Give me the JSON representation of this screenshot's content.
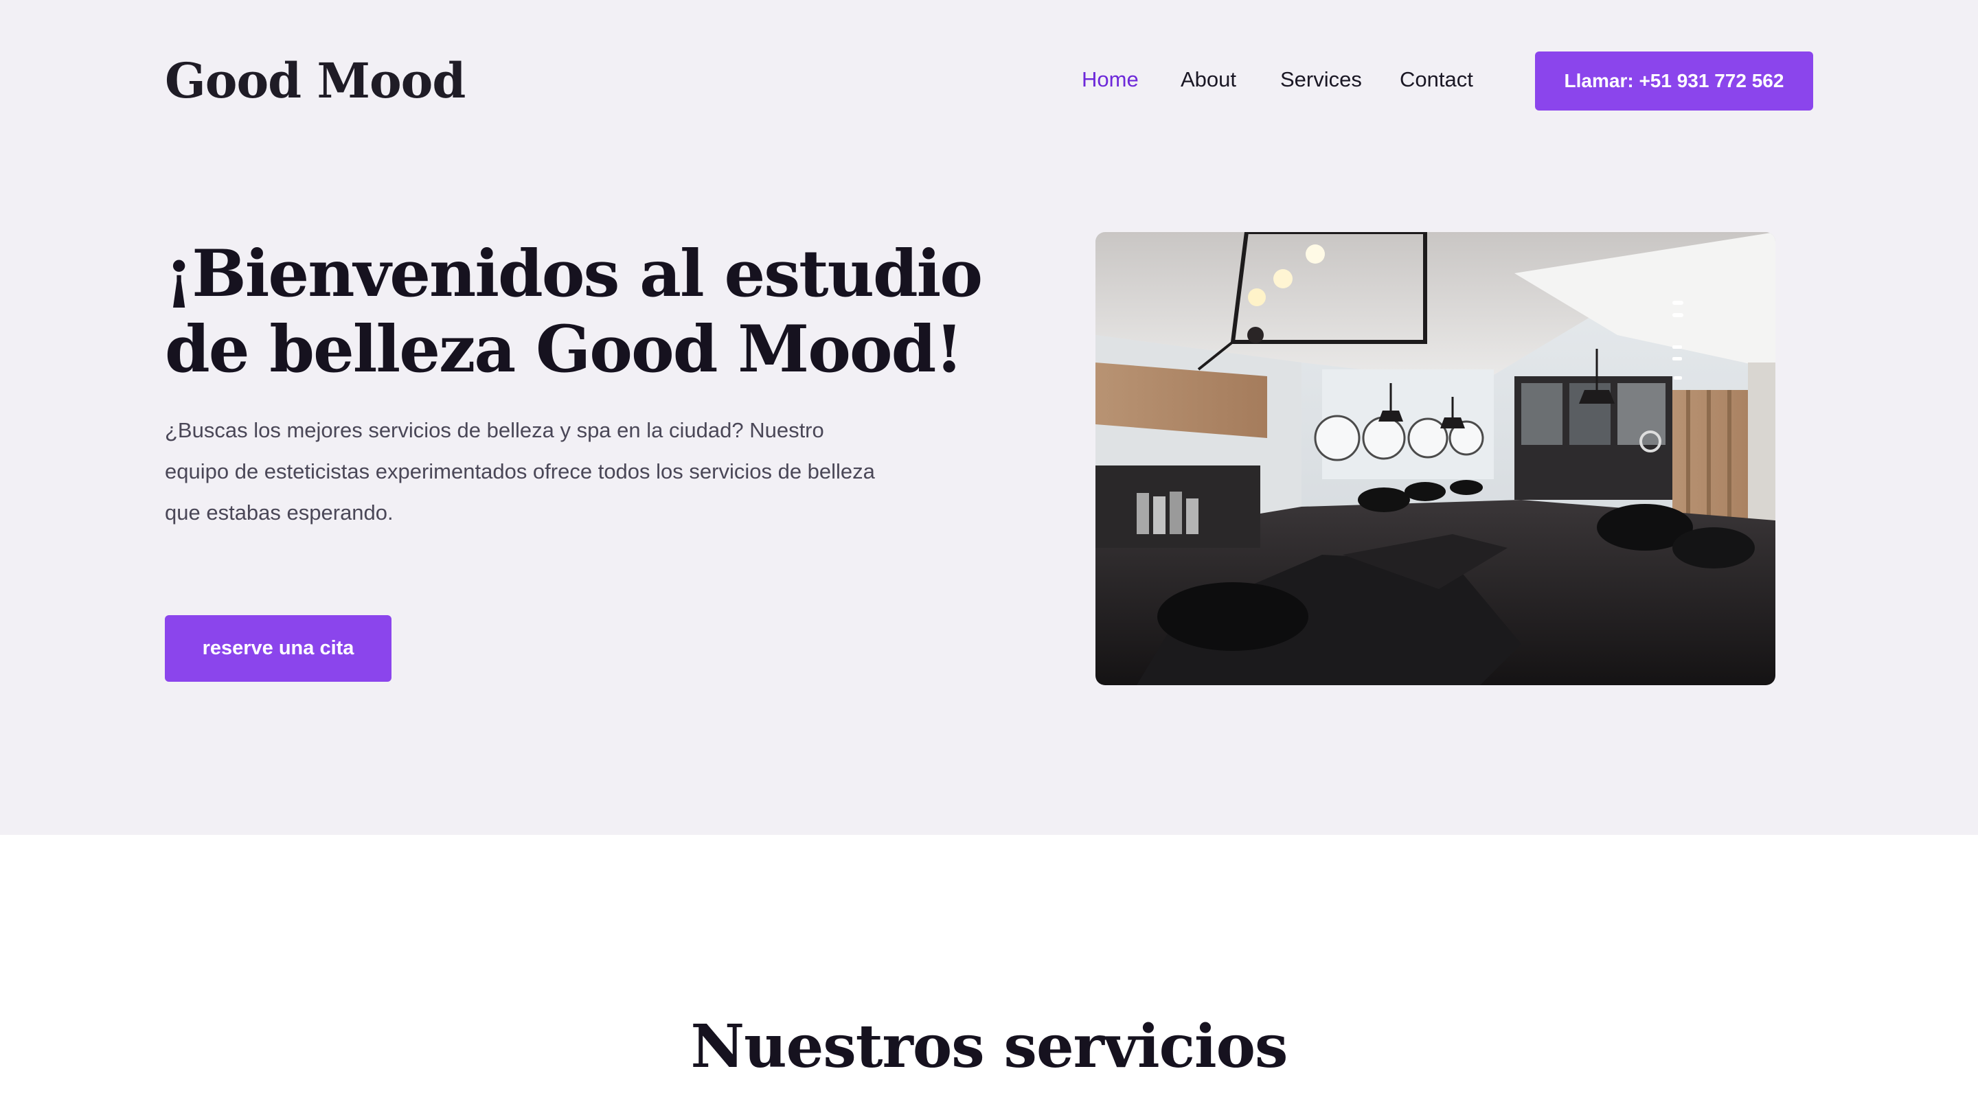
{
  "brand": {
    "logo_text": "Good Mood"
  },
  "nav": {
    "items": [
      {
        "label": "Home",
        "active": true
      },
      {
        "label": "About",
        "active": false
      },
      {
        "label": "Services",
        "active": false
      },
      {
        "label": "Contact",
        "active": false
      }
    ],
    "call_button_label": "Llamar: +51 931 772 562"
  },
  "hero": {
    "title_line1": "¡Bienvenidos al estudio",
    "title_line2": "de belleza Good Mood!",
    "description": "¿Buscas los mejores servicios de belleza y spa en la ciudad? Nuestro equipo de esteticistas experimentados ofrece todos los servicios de belleza que estabas esperando.",
    "cta_label": "reserve una cita",
    "image_subject": "beauty-salon-interior-photo"
  },
  "services": {
    "title": "Nuestros servicios"
  },
  "colors": {
    "accent": "#8b45ec",
    "nav_active": "#6d28d9",
    "hero_background": "#f2f0f5",
    "text_dark": "#16121f"
  }
}
